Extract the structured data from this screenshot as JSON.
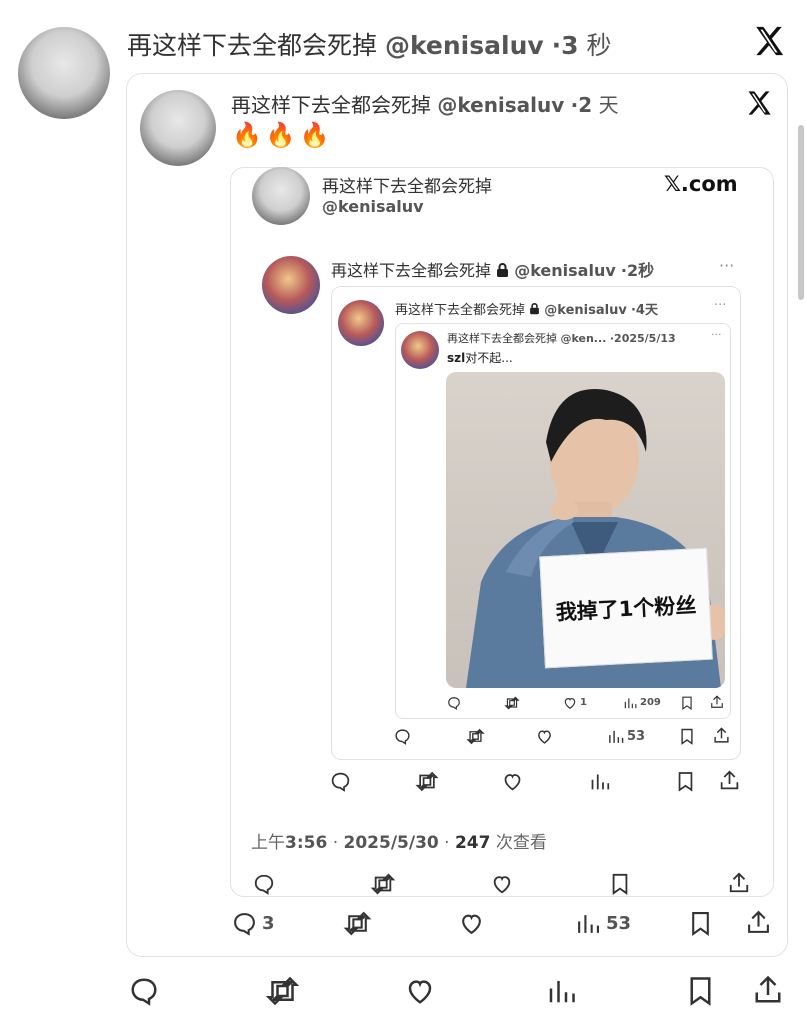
{
  "level0": {
    "name": "再这样下去全都会死掉",
    "handle": "@kenisaluv",
    "time_value": "3",
    "time_unit": "秒",
    "actions": {
      "reply_count": "",
      "views_count": ""
    }
  },
  "level1": {
    "name": "再这样下去全都会死掉",
    "handle": "@kenisaluv",
    "time_value": "2",
    "time_unit": "天",
    "body": "🔥🔥🔥",
    "actions": {
      "reply_count": "3",
      "views_count": "53"
    }
  },
  "level2": {
    "name": "再这样下去全都会死掉",
    "handle": "@kenisaluv",
    "brand": "𝕏.com",
    "timestamp_prefix": "上午",
    "timestamp_time": "3:56",
    "timestamp_date": "2025/5/30",
    "views_number": "247",
    "views_label": "次查看"
  },
  "level3": {
    "name": "再这样下去全都会死掉",
    "handle": "@kenisaluv",
    "time": "2秒",
    "more": "···"
  },
  "level4": {
    "name": "再这样下去全都会死掉",
    "handle": "@kenisaluv",
    "time": "4天",
    "more": "···",
    "actions": {
      "views_count": "53"
    }
  },
  "level5": {
    "name": "再这样下去全都会死掉",
    "handle": "@ken...",
    "date": "2025/5/13",
    "more": "···",
    "body_bold": "szl",
    "body_rest": "对不起...",
    "sign_text": "我掉了1个粉丝",
    "actions": {
      "like_count": "1",
      "views_count": "209"
    }
  },
  "colors": {
    "text": "#222222",
    "muted": "#555555",
    "border": "#e2e2e2"
  },
  "icons": [
    "x-logo-icon",
    "fire-icon",
    "reply-icon",
    "retweet-icon",
    "like-icon",
    "views-icon",
    "bookmark-icon",
    "share-icon",
    "lock-icon",
    "more-icon"
  ]
}
